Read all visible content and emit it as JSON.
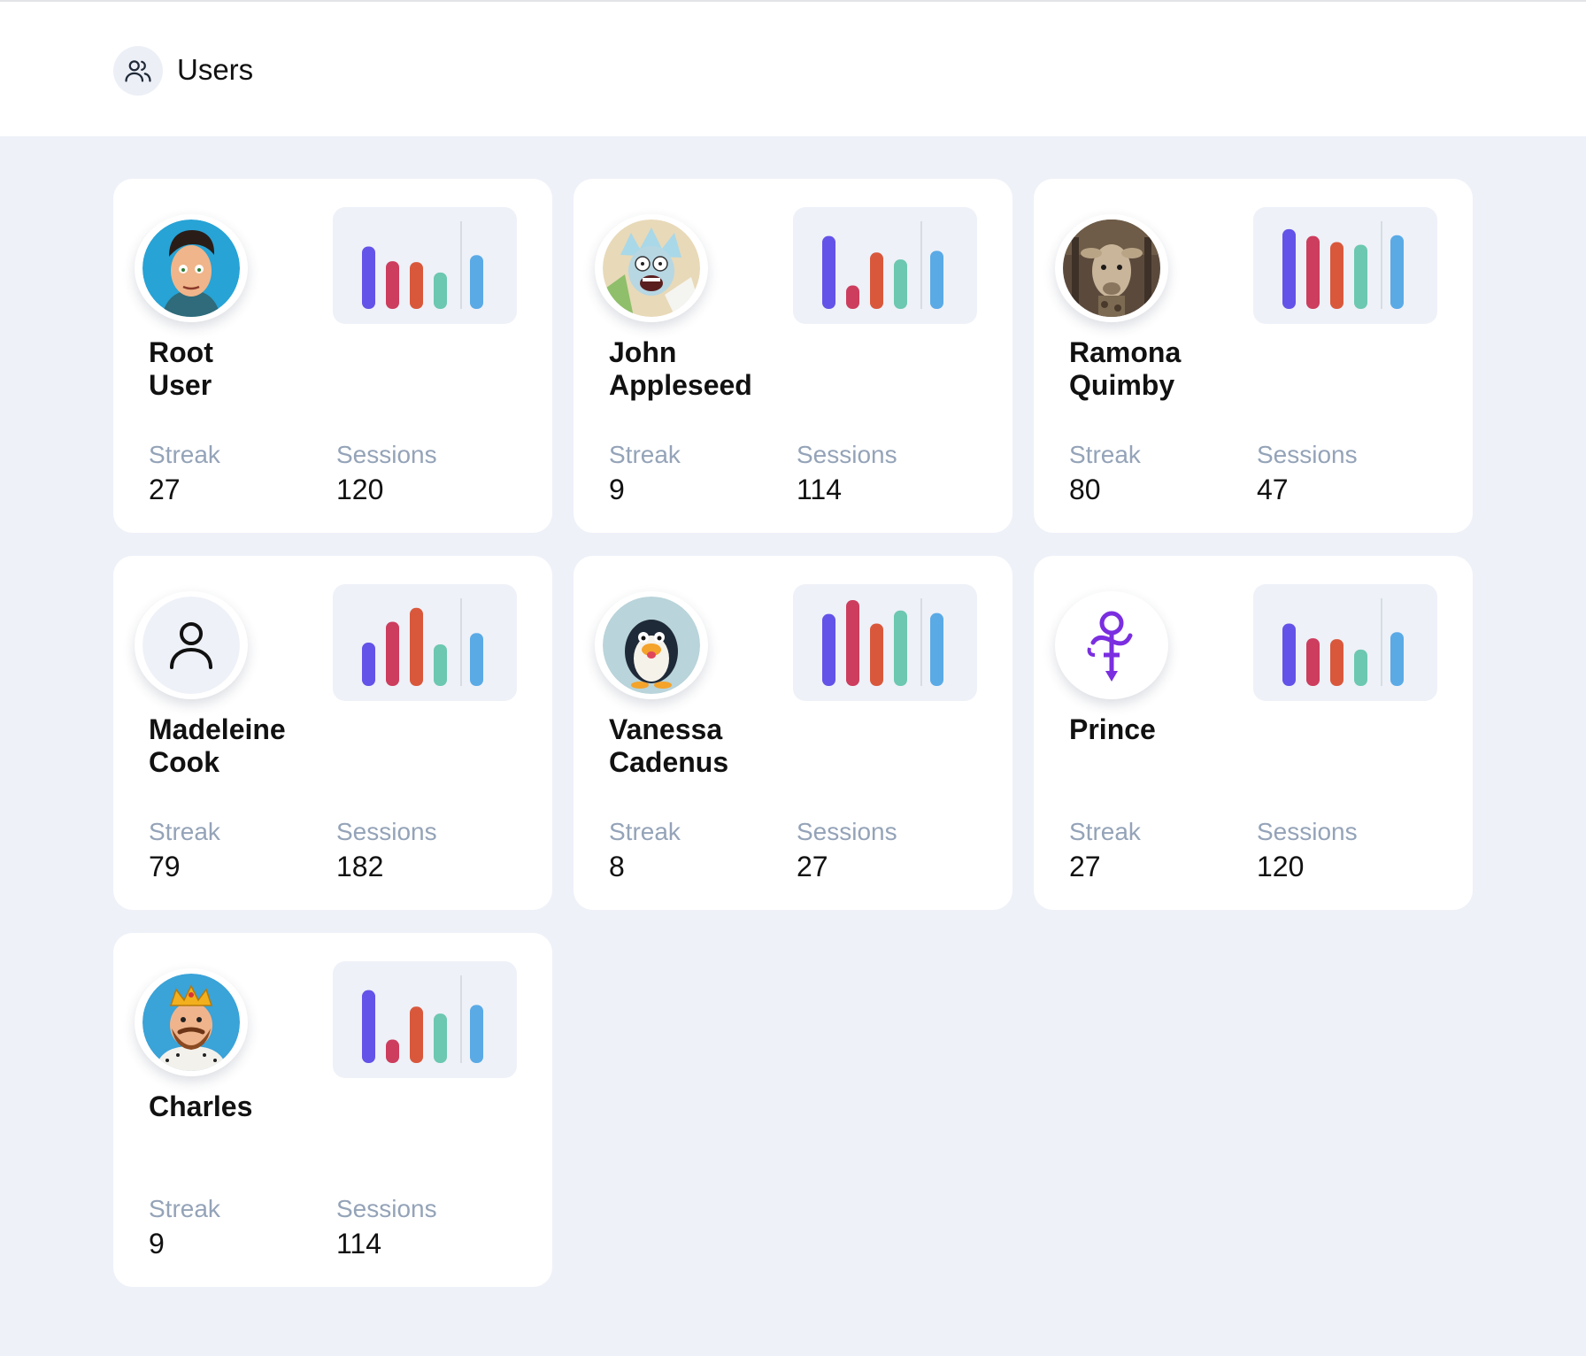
{
  "header": {
    "title": "Users",
    "icon": "users-icon"
  },
  "labels": {
    "streak": "Streak",
    "sessions": "Sessions"
  },
  "bar_colors": [
    "#6353e8",
    "#cd3d5e",
    "#d9583c",
    "#6cc8b0",
    "#5aaae6"
  ],
  "users": [
    {
      "first": "Root",
      "last": "User",
      "streak": "27",
      "sessions": "120",
      "avatar": "cartoon-man-avatar",
      "bars": [
        0.72,
        0.55,
        0.54,
        0.42,
        0.62
      ]
    },
    {
      "first": "John",
      "last": "Appleseed",
      "streak": "9",
      "sessions": "114",
      "avatar": "cartoon-scientist-avatar",
      "bars": [
        0.84,
        0.27,
        0.65,
        0.57,
        0.67
      ]
    },
    {
      "first": "Ramona",
      "last": "Quimby",
      "streak": "80",
      "sessions": "47",
      "avatar": "giraffe-photo-avatar",
      "bars": [
        0.92,
        0.84,
        0.77,
        0.74,
        0.85
      ]
    },
    {
      "first": "Madeleine",
      "last": "Cook",
      "streak": "79",
      "sessions": "182",
      "avatar": "person-icon",
      "bars": [
        0.5,
        0.74,
        0.9,
        0.48,
        0.61
      ]
    },
    {
      "first": "Vanessa",
      "last": "Cadenus",
      "streak": "8",
      "sessions": "27",
      "avatar": "penguin-avatar",
      "bars": [
        0.83,
        0.99,
        0.72,
        0.87,
        0.84
      ]
    },
    {
      "first": "Prince",
      "last": "",
      "streak": "27",
      "sessions": "120",
      "avatar": "love-symbol-icon",
      "bars": [
        0.72,
        0.55,
        0.54,
        0.42,
        0.62
      ]
    },
    {
      "first": "Charles",
      "last": "",
      "streak": "9",
      "sessions": "114",
      "avatar": "king-avatar",
      "bars": [
        0.84,
        0.27,
        0.65,
        0.57,
        0.67
      ]
    }
  ]
}
